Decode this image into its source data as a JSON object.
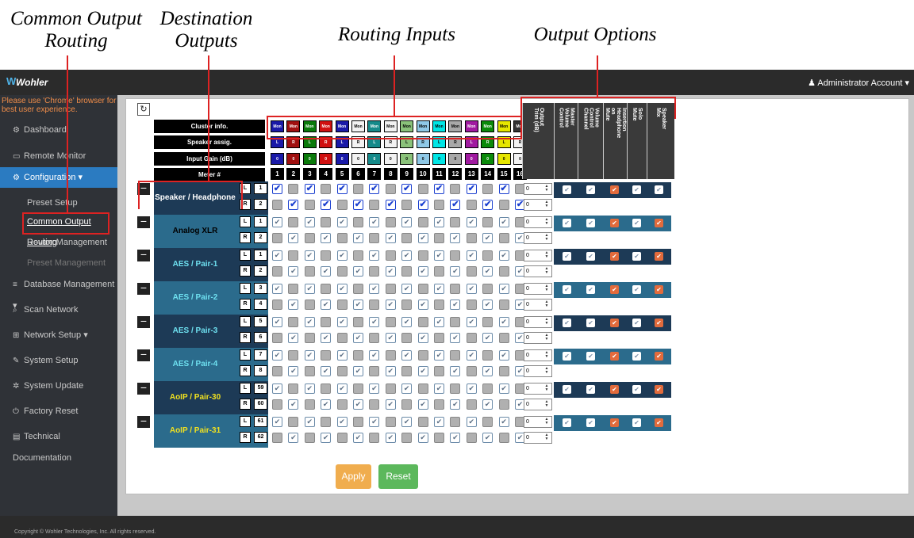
{
  "annotations": {
    "common_output_routing": "Common Output\nRouting",
    "destination_outputs": "Destination\nOutputs",
    "routing_inputs": "Routing Inputs",
    "output_options": "Output Options"
  },
  "app": {
    "logo": "Wohler",
    "account": "Administrator Account",
    "browser_notice": "Please use 'Chrome' browser for best user experience."
  },
  "sidebar": {
    "items": [
      {
        "label": "Dashboard",
        "icon": "dashboard-icon"
      },
      {
        "label": "Remote Monitor",
        "icon": "monitor-icon"
      },
      {
        "label": "Configuration",
        "icon": "cogs-icon",
        "active": true
      },
      {
        "label": "Preset Setup"
      },
      {
        "label": "Common Output Routing",
        "selected": true
      },
      {
        "label": "Device Management"
      },
      {
        "label": "Preset Management"
      },
      {
        "label": "Database Management",
        "icon": "database-icon"
      },
      {
        "label": "Scan Network",
        "icon": "search-icon"
      },
      {
        "label": "Network Setup",
        "icon": "sitemap-icon"
      },
      {
        "label": "System Setup",
        "icon": "wrench-icon"
      },
      {
        "label": "System Update",
        "icon": "gear-icon"
      },
      {
        "label": "Factory Reset",
        "icon": "power-icon"
      },
      {
        "label": "Technical Documentation",
        "icon": "book-icon"
      }
    ]
  },
  "matrix": {
    "header_labels": [
      "Cluster info.",
      "Speaker assig.",
      "Input Gain (dB)",
      "Meter #"
    ],
    "cluster_label": "Mon",
    "cluster_colors": [
      "#1a1aa8",
      "#a01010",
      "#0a7a0a",
      "#d01010",
      "#1a1aa8",
      "#f2f2f2",
      "#158a8a",
      "#f2f2f2",
      "#8ac27a",
      "#8ec8e6",
      "#00e6e6",
      "#a8a8a8",
      "#a01aa0",
      "#0a8a0a",
      "#e6e600",
      "#333333"
    ],
    "speaker_assign": [
      "L",
      "R",
      "L",
      "R",
      "L",
      "R",
      "L",
      "R",
      "L",
      "R",
      "L",
      "R",
      "L",
      "R",
      "L",
      "R"
    ],
    "speaker_colors": [
      "#1a1aa8",
      "#a01010",
      "#0a7a0a",
      "#d01010",
      "#1a1aa8",
      "#f2f2f2",
      "#158a8a",
      "#f2f2f2",
      "#8ac27a",
      "#8ec8e6",
      "#00e6e6",
      "#a8a8a8",
      "#a01aa0",
      "#0a8a0a",
      "#e6e600",
      "#f2f2f2"
    ],
    "input_gain": [
      "0",
      "0",
      "0",
      "0",
      "0",
      "0",
      "0",
      "0",
      "0",
      "0",
      "0",
      "0",
      "0",
      "0",
      "0",
      "0"
    ],
    "meters": [
      "1",
      "2",
      "3",
      "4",
      "5",
      "6",
      "7",
      "8",
      "9",
      "10",
      "11",
      "12",
      "13",
      "14",
      "15",
      "16"
    ]
  },
  "destinations": [
    {
      "name": "Speaker / Headphone",
      "channels": [
        [
          "L",
          "1"
        ],
        [
          "R",
          "2"
        ]
      ],
      "color": "#1d3a56",
      "text": "#fff",
      "opts": [
        "w",
        "w",
        "o",
        "w",
        "w"
      ]
    },
    {
      "name": "Analog XLR",
      "channels": [
        [
          "L",
          "1"
        ],
        [
          "R",
          "2"
        ]
      ],
      "color": "#2b6b8c",
      "text": "#000",
      "opts": [
        "w",
        "w",
        "o",
        "w",
        "o"
      ]
    },
    {
      "name": "AES / Pair-1",
      "channels": [
        [
          "L",
          "1"
        ],
        [
          "R",
          "2"
        ]
      ],
      "color": "#1d3a56",
      "text": "#6ee0f0",
      "opts": [
        "w",
        "w",
        "o",
        "w",
        "o"
      ]
    },
    {
      "name": "AES / Pair-2",
      "channels": [
        [
          "L",
          "3"
        ],
        [
          "R",
          "4"
        ]
      ],
      "color": "#2b6b8c",
      "text": "#6ee0f0",
      "opts": [
        "w",
        "w",
        "o",
        "w",
        "o"
      ]
    },
    {
      "name": "AES / Pair-3",
      "channels": [
        [
          "L",
          "5"
        ],
        [
          "R",
          "6"
        ]
      ],
      "color": "#1d3a56",
      "text": "#6ee0f0",
      "opts": [
        "w",
        "w",
        "o",
        "w",
        "o"
      ]
    },
    {
      "name": "AES / Pair-4",
      "channels": [
        [
          "L",
          "7"
        ],
        [
          "R",
          "8"
        ]
      ],
      "color": "#2b6b8c",
      "text": "#6ee0f0",
      "opts": [
        "w",
        "w",
        "o",
        "w",
        "o"
      ]
    },
    {
      "name": "AoIP / Pair-30",
      "channels": [
        [
          "L",
          "59"
        ],
        [
          "R",
          "60"
        ]
      ],
      "color": "#1d3a56",
      "text": "#f0e020",
      "opts": [
        "w",
        "w",
        "o",
        "w",
        "o"
      ]
    },
    {
      "name": "AoIP / Pair-31",
      "channels": [
        [
          "L",
          "61"
        ],
        [
          "R",
          "62"
        ]
      ],
      "color": "#2b6b8c",
      "text": "#f0e020",
      "opts": [
        "w",
        "w",
        "o",
        "w",
        "o"
      ]
    }
  ],
  "trim_value": "0",
  "option_headers": [
    "Output\nTrim (dB)",
    "Master\nVolume\nControl",
    "Volume\nControl\nChannel",
    "Insertion\nHeadphone\non\nMute",
    "Solo\nMute",
    "Speaker\nMix"
  ],
  "buttons": {
    "apply": "Apply",
    "reset": "Reset"
  },
  "footer": {
    "copyright": "Copyright © Wohler Technologies, Inc. All rights reserved."
  },
  "colors": {
    "apply": "#f0ad4e",
    "reset": "#5cb85c",
    "active": "#2b7bc1",
    "highlight": "#d22222"
  }
}
